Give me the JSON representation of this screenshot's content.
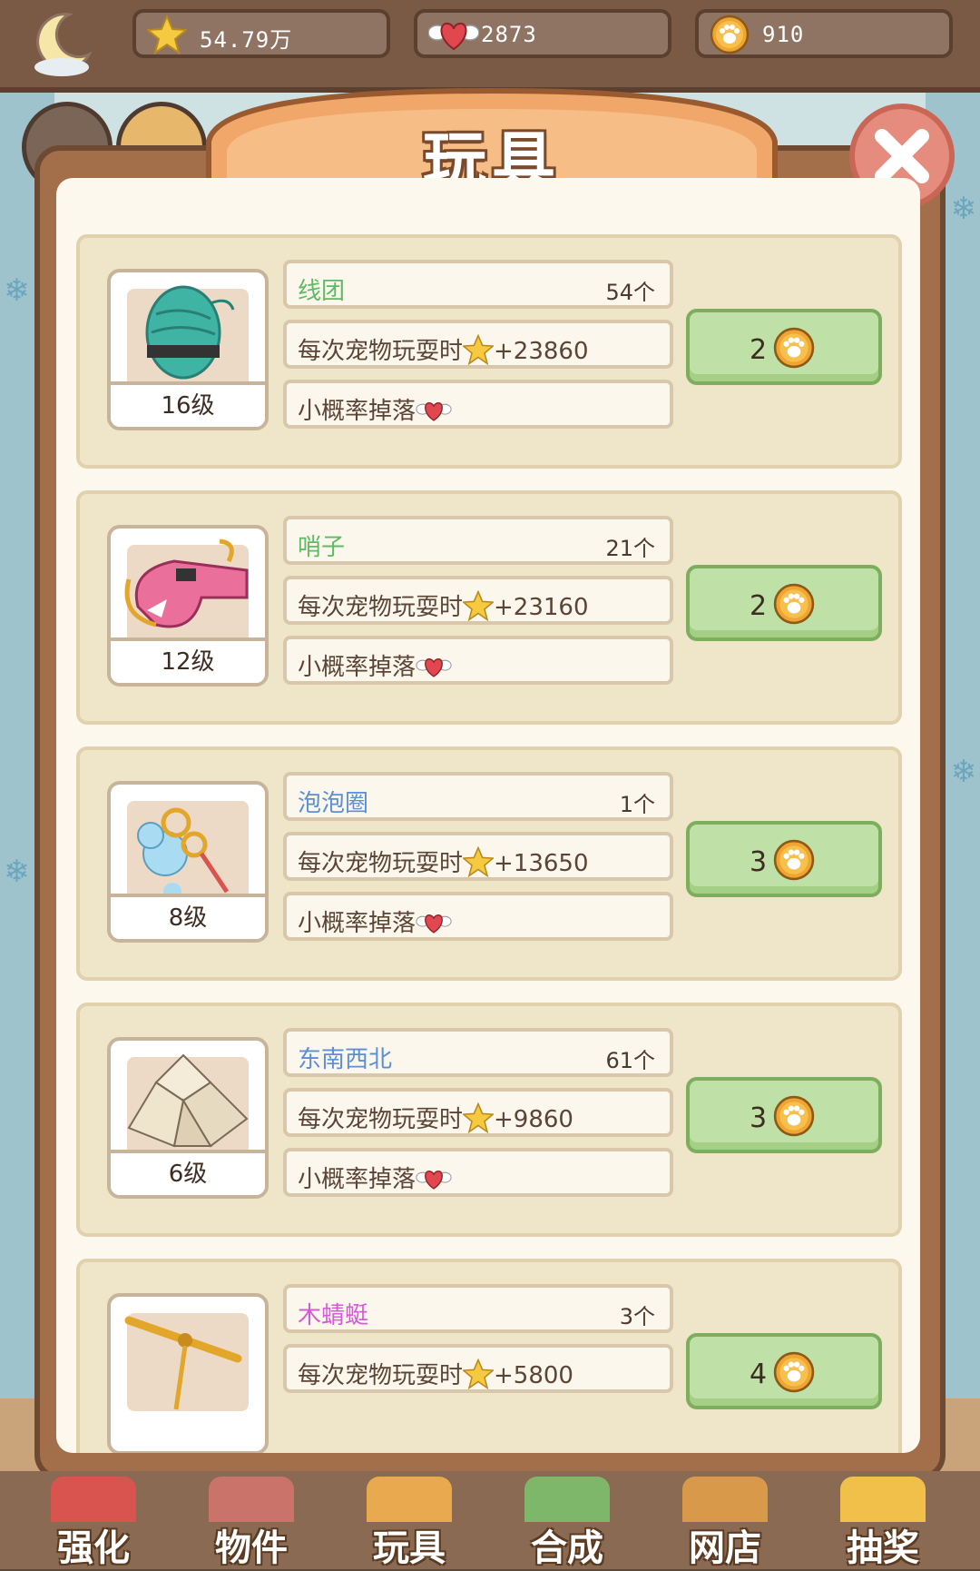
{
  "resources": [
    {
      "icon": "star-icon",
      "value": "54.79万"
    },
    {
      "icon": "winged-heart-icon",
      "value": "2873"
    },
    {
      "icon": "paw-coin-icon",
      "value": "910"
    }
  ],
  "modal": {
    "title": "玩具",
    "close_icon": "close-icon"
  },
  "items": [
    {
      "name": "线团",
      "name_color": "#5dbb63",
      "count": "54个",
      "level": "16级",
      "effect_prefix": "每次宠物玩耍时",
      "effect_value": "+23860",
      "drop_text": "小概率掉落",
      "price": "2",
      "icon": "yarn-ball-icon"
    },
    {
      "name": "哨子",
      "name_color": "#5dbb63",
      "count": "21个",
      "level": "12级",
      "effect_prefix": "每次宠物玩耍时",
      "effect_value": "+23160",
      "drop_text": "小概率掉落",
      "price": "2",
      "icon": "whistle-icon"
    },
    {
      "name": "泡泡圈",
      "name_color": "#5c8fd6",
      "count": "1个",
      "level": "8级",
      "effect_prefix": "每次宠物玩耍时",
      "effect_value": "+13650",
      "drop_text": "小概率掉落",
      "price": "3",
      "icon": "bubble-wand-icon"
    },
    {
      "name": "东南西北",
      "name_color": "#5c8fd6",
      "count": "61个",
      "level": "6级",
      "effect_prefix": "每次宠物玩耍时",
      "effect_value": "+9860",
      "drop_text": "小概率掉落",
      "price": "3",
      "icon": "paper-fortune-teller-icon"
    },
    {
      "name": "木蜻蜓",
      "name_color": "#d659d8",
      "count": "3个",
      "level": "",
      "effect_prefix": "每次宠物玩耍时",
      "effect_value": "+5800",
      "drop_text": "",
      "price": "4",
      "icon": "bamboo-dragonfly-icon"
    }
  ],
  "nav": [
    {
      "label": "强化",
      "icon": "target-icon"
    },
    {
      "label": "物件",
      "icon": "furniture-icon"
    },
    {
      "label": "玩具",
      "icon": "toy-icon"
    },
    {
      "label": "合成",
      "icon": "craft-icon"
    },
    {
      "label": "网店",
      "icon": "shop-icon"
    },
    {
      "label": "抽奖",
      "icon": "lottery-icon"
    }
  ],
  "colors": {
    "accent_green": "#bfe0a6",
    "panel_brown": "#a36f4a",
    "title_orange": "#f1a866"
  }
}
